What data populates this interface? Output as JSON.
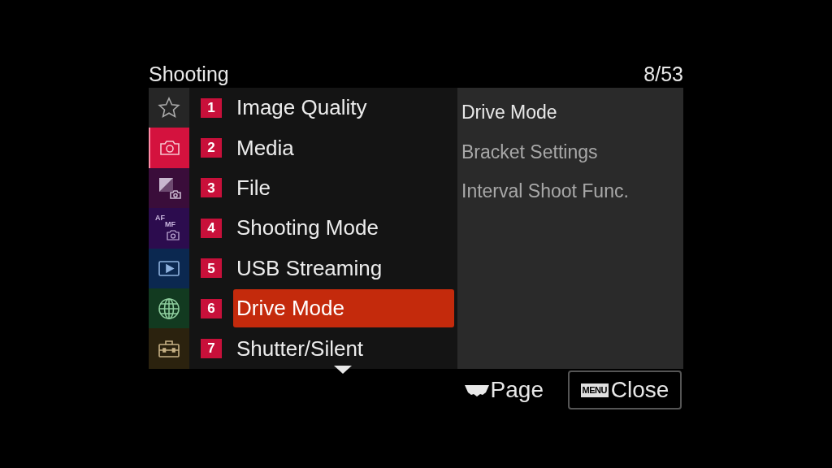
{
  "header": {
    "title": "Shooting",
    "page": "8/53"
  },
  "tabs": [
    {
      "kind": "favorite",
      "color": "#262626",
      "selected": false
    },
    {
      "kind": "camera",
      "color": "#d4123e",
      "selected": true
    },
    {
      "kind": "exposure",
      "color": "#3a0d3a",
      "selected": false
    },
    {
      "kind": "focus",
      "color": "#2c0c4e",
      "selected": false,
      "texts": [
        "AF",
        "MF"
      ]
    },
    {
      "kind": "playback",
      "color": "#0b2850",
      "selected": false
    },
    {
      "kind": "network",
      "color": "#123a20",
      "selected": false
    },
    {
      "kind": "setup",
      "color": "#2b220e",
      "selected": false
    }
  ],
  "menu_items": [
    {
      "number": "1",
      "label": "Image Quality",
      "selected": false
    },
    {
      "number": "2",
      "label": "Media",
      "selected": false
    },
    {
      "number": "3",
      "label": "File",
      "selected": false
    },
    {
      "number": "4",
      "label": "Shooting Mode",
      "selected": false
    },
    {
      "number": "5",
      "label": "USB Streaming",
      "selected": false
    },
    {
      "number": "6",
      "label": "Drive Mode",
      "selected": true
    },
    {
      "number": "7",
      "label": "Shutter/Silent",
      "selected": false
    }
  ],
  "sub_items": [
    {
      "label": "Drive Mode",
      "disabled": false
    },
    {
      "label": "Bracket Settings",
      "disabled": true
    },
    {
      "label": "Interval Shoot Func.",
      "disabled": true
    }
  ],
  "footer": {
    "page_label": "Page",
    "close": {
      "badge": "MENU",
      "label": "Close"
    }
  }
}
